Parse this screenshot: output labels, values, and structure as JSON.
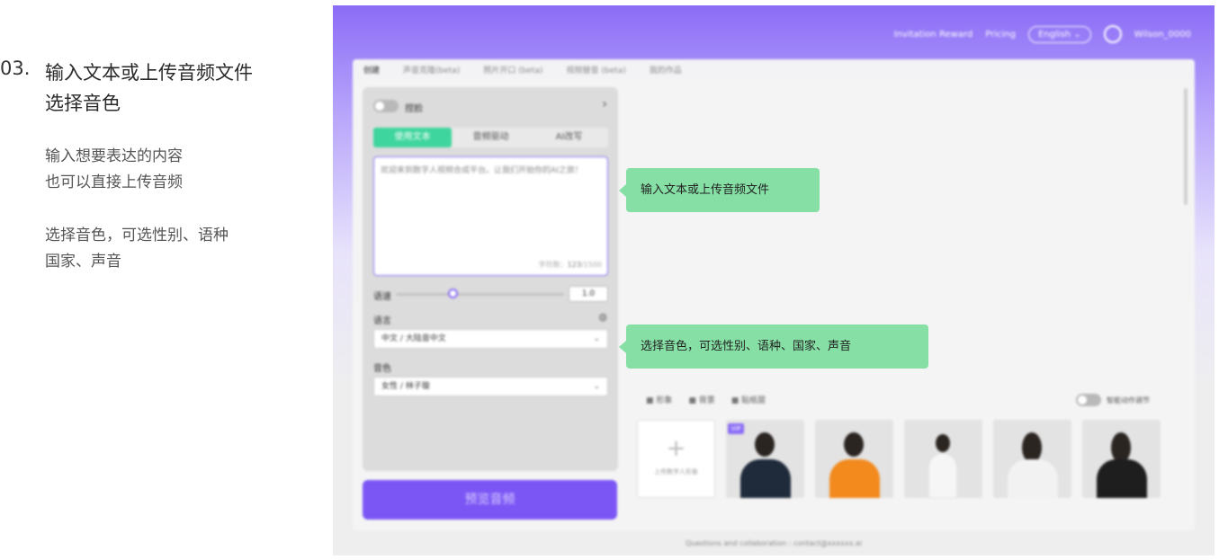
{
  "instructions": {
    "step_number": "03.",
    "title_line1": "输入文本或上传音频文件",
    "title_line2": "选择音色",
    "desc1_line1": "输入想要表达的内容",
    "desc1_line2": "也可以直接上传音频",
    "desc2_line1": "选择音色，可选性别、语种",
    "desc2_line2": "国家、声音"
  },
  "app": {
    "nav": {
      "link1": "Invitation Reward",
      "link2": "Pricing",
      "language": "English",
      "user": "Wilson_0000"
    },
    "tabs": [
      "创建",
      "声音克隆(beta)",
      "照片开口 (beta)",
      "视频替音 (beta)",
      "我的作品"
    ],
    "panel": {
      "toggle_label": "捏脸",
      "segments": [
        "使用文本",
        "音频驱动",
        "AI改写"
      ],
      "text_content": "欢迎来到数字人视频合成平台。让我们开始你的AI之旅！",
      "char_count_label": "字符数：",
      "char_count": "123",
      "char_max": "/1500",
      "speed_label": "语速",
      "speed_value": "1.0",
      "speed_level": 0.4,
      "language_label": "语言",
      "language_value": "中文  /  大陆音中文",
      "voice_label": "音色",
      "voice_value": "女性  /  林子璇",
      "preview_button": "预览音频"
    },
    "avatar_section": {
      "tabs": [
        "形象",
        "背景",
        "贴纸层"
      ],
      "toggle_label": "智能动作调节",
      "upload_label": "上传数字人形象",
      "badge": "VIP",
      "avatars": [
        "avatar-1",
        "avatar-2",
        "avatar-3",
        "avatar-4",
        "avatar-5"
      ]
    },
    "footer": "Questions and collaboration : contact@xxxxxx.ai"
  },
  "callouts": {
    "text_upload": "输入文本或上传音频文件",
    "voice_select": "选择音色，可选性别、语种、国家、声音"
  },
  "colors": {
    "brand_purple": "#8b6cf6",
    "accent_green": "#3fd59e",
    "callout_green": "#86e0a5"
  }
}
